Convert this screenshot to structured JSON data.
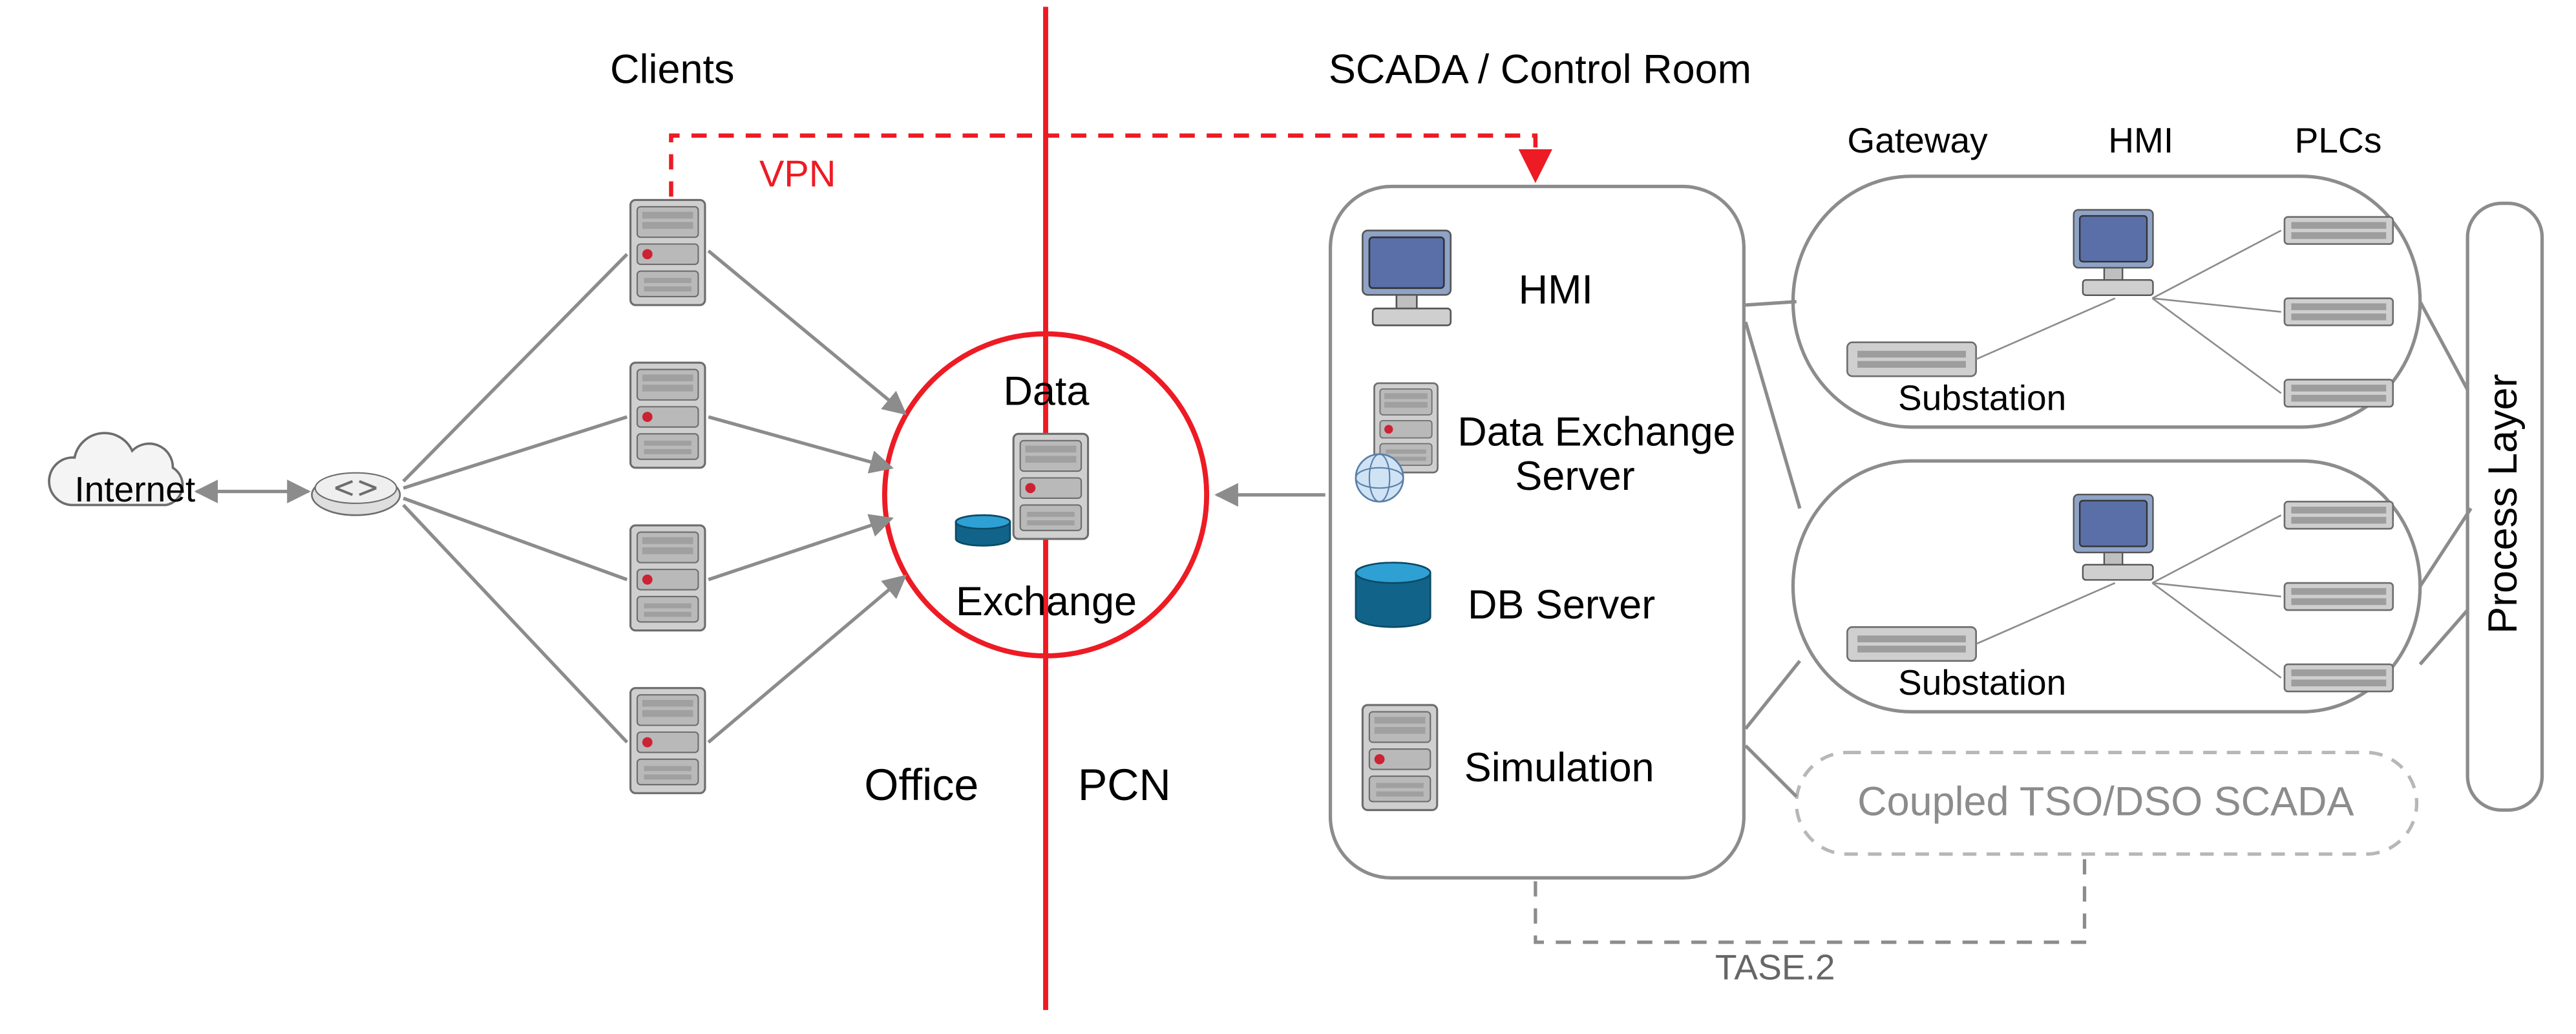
{
  "labels": {
    "clients": "Clients",
    "scada_room": "SCADA / Control Room",
    "gateway": "Gateway",
    "hmi_col": "HMI",
    "plcs": "PLCs",
    "vpn": "VPN",
    "internet": "Internet",
    "data": "Data",
    "exchange": "Exchange",
    "office": "Office",
    "pcn": "PCN",
    "hmi": "HMI",
    "data_exch_server_line1": "Data Exchange",
    "data_exch_server_line2": "Server",
    "db_server": "DB Server",
    "simulation": "Simulation",
    "substation1": "Substation",
    "substation2": "Substation",
    "coupled": "Coupled TSO/DSO SCADA",
    "tase2": "TASE.2",
    "process_layer": "Process Layer"
  },
  "colors": {
    "red": "#ed1b24",
    "gray": "#8c8c8c",
    "dark": "#444",
    "teal_dark": "#12638a",
    "teal_light": "#2ea0d4"
  }
}
